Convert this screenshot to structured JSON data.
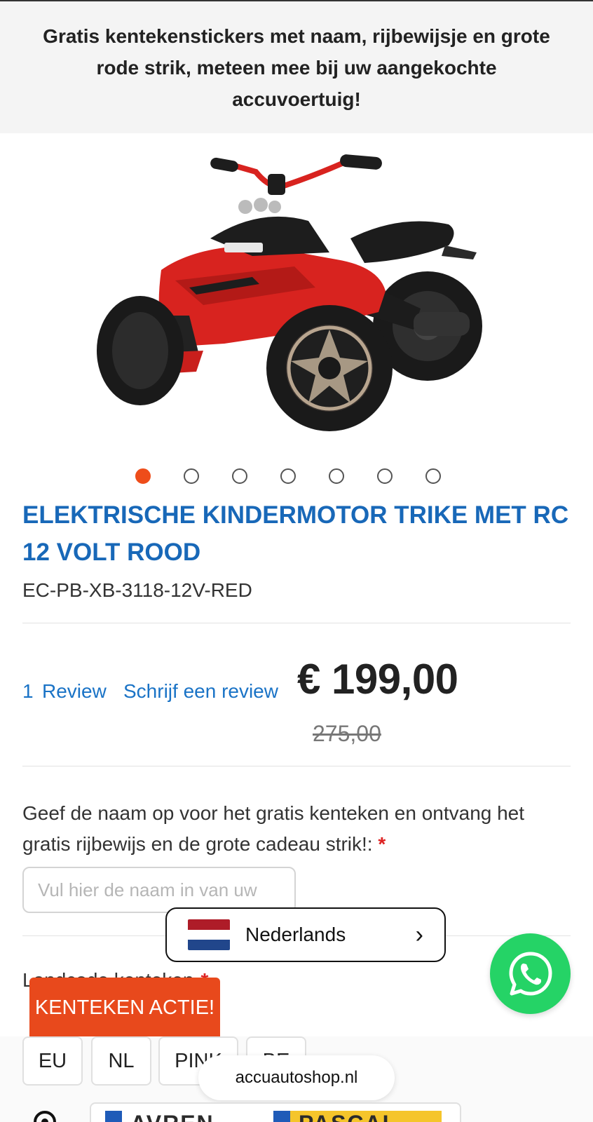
{
  "promo": {
    "text": "Gratis kentekenstickers met naam, rijbewijsje en grote rode strik, meteen mee bij uw aangekochte accuvoertuig!"
  },
  "gallery": {
    "count": 7,
    "active_index": 0,
    "accent": "#ee4d1a"
  },
  "product": {
    "title": "ELEKTRISCHE KINDERMOTOR TRIKE MET RC 12 VOLT ROOD",
    "sku": "EC-PB-XB-3118-12V-RED",
    "title_color": "#1868b8"
  },
  "reviews": {
    "count": "1",
    "review_label": "Review",
    "write_label": "Schrijf een review"
  },
  "pricing": {
    "price": "€ 199,00",
    "old_price": "275,00"
  },
  "name_field": {
    "label": "Geef de naam op voor het gratis kenteken en ontvang het gratis rijbewijs en de grote cadeau strik!:",
    "required_mark": "*",
    "placeholder": "Vul hier de naam in van uw"
  },
  "country_plate": {
    "label": "Landcode kenteken",
    "required_mark": "*",
    "options": [
      "EU",
      "NL",
      "PINK",
      "BE"
    ]
  },
  "language": {
    "label": "Nederlands",
    "chevron": "›",
    "flag_colors": [
      "#ae1c28",
      "#ffffff",
      "#21468b"
    ]
  },
  "whatsapp": {
    "icon": "whatsapp-icon",
    "color": "#25d366"
  },
  "plate_promo": {
    "label": "KENTEKEN ACTIE!",
    "color": "#e8491c"
  },
  "browser": {
    "domain": "accuautoshop.nl"
  },
  "plate_preview": {
    "left_text": "AVREN",
    "right_text": "PASCAL"
  }
}
